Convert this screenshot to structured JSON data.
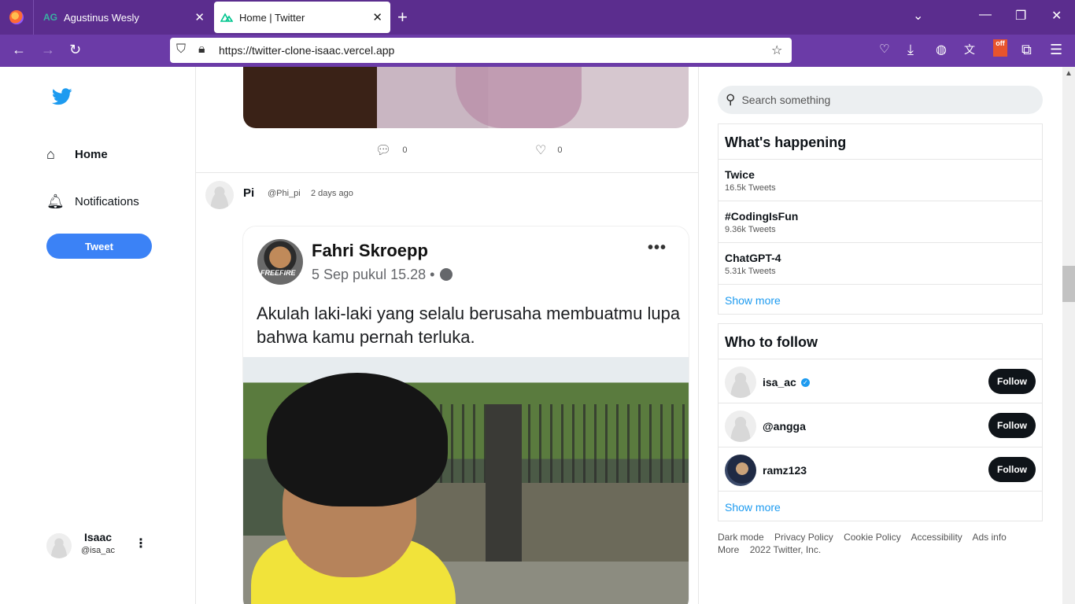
{
  "browser": {
    "tabs": [
      {
        "favicon": "AG",
        "title": "Agustinus Wesly",
        "active": false
      },
      {
        "favicon": "nuxt-icon",
        "title": "Home | Twitter",
        "active": true
      }
    ],
    "url": "https://twitter-clone-isaac.vercel.app",
    "ext_badge": "off"
  },
  "sidebar": {
    "items": [
      {
        "label": "Home",
        "icon": "home-icon"
      },
      {
        "label": "Notifications",
        "icon": "bell-icon"
      }
    ],
    "tweet_label": "Tweet",
    "user": {
      "name": "Isaac",
      "handle": "@isa_ac"
    }
  },
  "feed": {
    "prev_tweet": {
      "comments": "0",
      "likes": "0"
    },
    "post": {
      "name": "Pi",
      "handle": "@Phi_pi",
      "time": "2 days ago",
      "embed": {
        "author": "Fahri Skroepp",
        "date": "5 Sep pukul 15.28 •",
        "avatar_text": "FREEFIRE",
        "text": "Akulah laki-laki yang selalu berusaha membuatmu lupa bahwa kamu pernah terluka."
      }
    }
  },
  "right": {
    "search_placeholder": "Search something",
    "trends_title": "What's happening",
    "trends": [
      {
        "name": "Twice",
        "count": "16.5k Tweets"
      },
      {
        "name": "#CodingIsFun",
        "count": "9.36k Tweets"
      },
      {
        "name": "ChatGPT-4",
        "count": "5.31k Tweets"
      }
    ],
    "show_more": "Show more",
    "follow_title": "Who to follow",
    "follow": [
      {
        "name": "isa_ac",
        "verified": true,
        "button": "Follow"
      },
      {
        "name": "@angga",
        "verified": false,
        "button": "Follow"
      },
      {
        "name": "ramz123",
        "verified": false,
        "button": "Follow"
      }
    ],
    "footer": [
      "Dark mode",
      "Privacy Policy",
      "Cookie Policy",
      "Accessibility",
      "Ads info",
      "More",
      "2022 Twitter, Inc."
    ]
  },
  "colors": {
    "accent": "#1d9bf0",
    "tweet_button": "#3b82f6",
    "browser_chrome": "#5b2d8e"
  }
}
